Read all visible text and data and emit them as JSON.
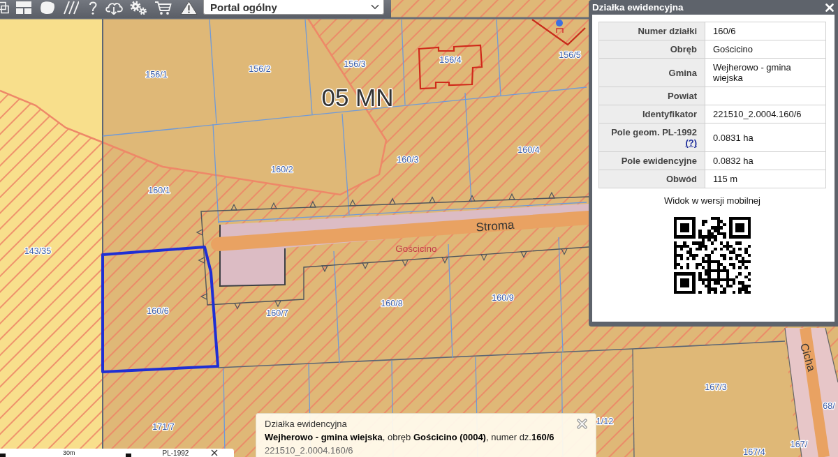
{
  "toolbar": {
    "portal_select": {
      "value": "Portal ogólny"
    }
  },
  "map": {
    "parcel_labels": [
      "156/1",
      "156/2",
      "156/3",
      "156/4",
      "156/5",
      "160/1",
      "160/2",
      "160/3",
      "160/4",
      "143/35",
      "160/6",
      "160/7",
      "160/8",
      "160/9",
      "167/3",
      "68/",
      "171/7",
      "1/12",
      "167/",
      "167/4"
    ],
    "zone_label": "05 MN",
    "street_labels": [
      "Stroma",
      "Cicha"
    ],
    "place_label": "Gościcino"
  },
  "parcel_popup": {
    "title": "Działka ewidencyjna",
    "rows": [
      {
        "label": "Numer działki",
        "value": "160/6"
      },
      {
        "label": "Obręb",
        "value": "Gościcino"
      },
      {
        "label": "Gmina",
        "value": "Wejherowo - gmina wiejska"
      },
      {
        "label": "Powiat"
      },
      {
        "label": "Identyfikator",
        "value": "221510_2.0004.160/6"
      },
      {
        "label": "Pole geom. PL-1992",
        "help_link": "(?)",
        "value": "0.0831 ha"
      },
      {
        "label": "Pole ewidencyjne",
        "value": "0.0832 ha"
      },
      {
        "label": "Obwód",
        "value": "115 m"
      }
    ],
    "mobile_view_label": "Widok w wersji mobilnej"
  },
  "hover_tooltip": {
    "title": "Działka ewidencyjna",
    "summary": "**Wejherowo - gmina wiejska**, obręb **Gościcino (0004)**, numer dz.**160/6**",
    "identifier": "221510_2.0004.160/6"
  },
  "scale_bar": {
    "distance": "30m",
    "crs": "PL-1992"
  }
}
